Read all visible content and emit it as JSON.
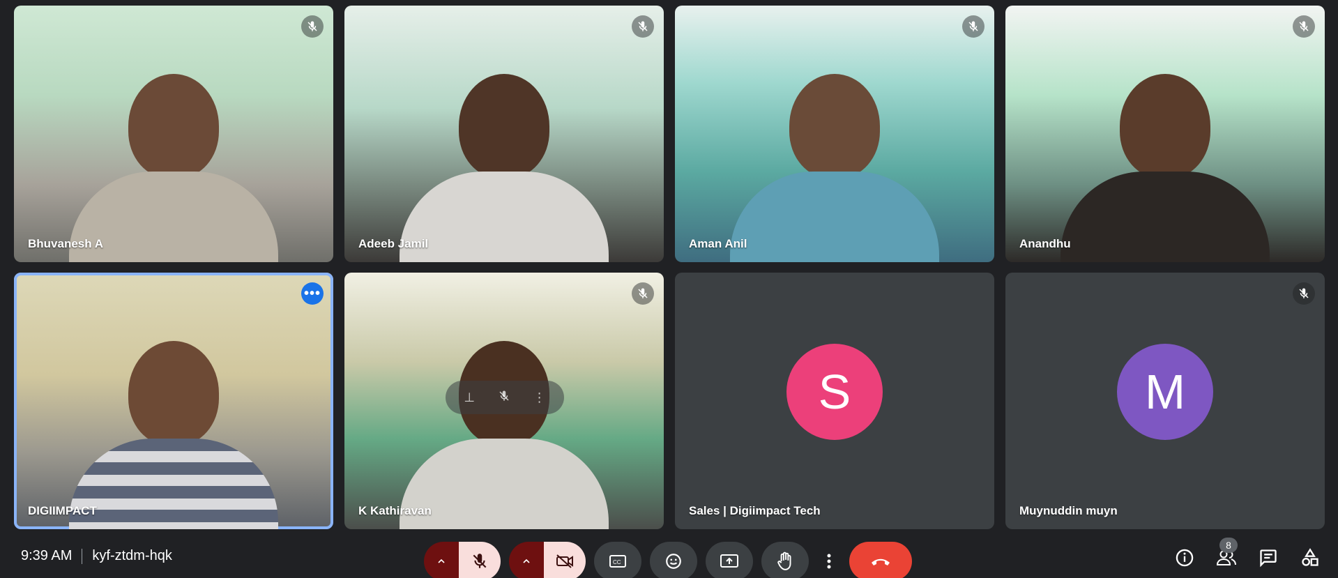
{
  "participants": [
    {
      "name": "Bhuvanesh A",
      "muted": true
    },
    {
      "name": "Adeeb Jamil",
      "muted": true
    },
    {
      "name": "Aman Anil",
      "muted": true
    },
    {
      "name": "Anandhu",
      "muted": true
    },
    {
      "name": "DIGIIMPACT",
      "muted": false
    },
    {
      "name": "K Kathiravan",
      "muted": true
    },
    {
      "name": "Sales | Digiimpact Tech",
      "muted": false,
      "avatar_letter": "S",
      "avatar_color": "#ec407a"
    },
    {
      "name": "Muynuddin muyn",
      "muted": true,
      "avatar_letter": "M",
      "avatar_color": "#7e57c2"
    }
  ],
  "footer": {
    "time": "9:39 AM",
    "meeting_code": "kyf-ztdm-hqk",
    "people_count": "8"
  },
  "colors": {
    "background": "#202124",
    "tile": "#3c4043",
    "active_border": "#8ab4f8",
    "hangup": "#ea4335",
    "mic_off_bg": "#f9dedc"
  },
  "icons": [
    "mic-off-icon",
    "more-options-icon",
    "chevron-up-icon",
    "camera-off-icon",
    "captions-icon",
    "emoji-icon",
    "present-icon",
    "raise-hand-icon",
    "more-vert-icon",
    "hangup-icon",
    "info-icon",
    "people-icon",
    "chat-icon",
    "activities-icon"
  ]
}
